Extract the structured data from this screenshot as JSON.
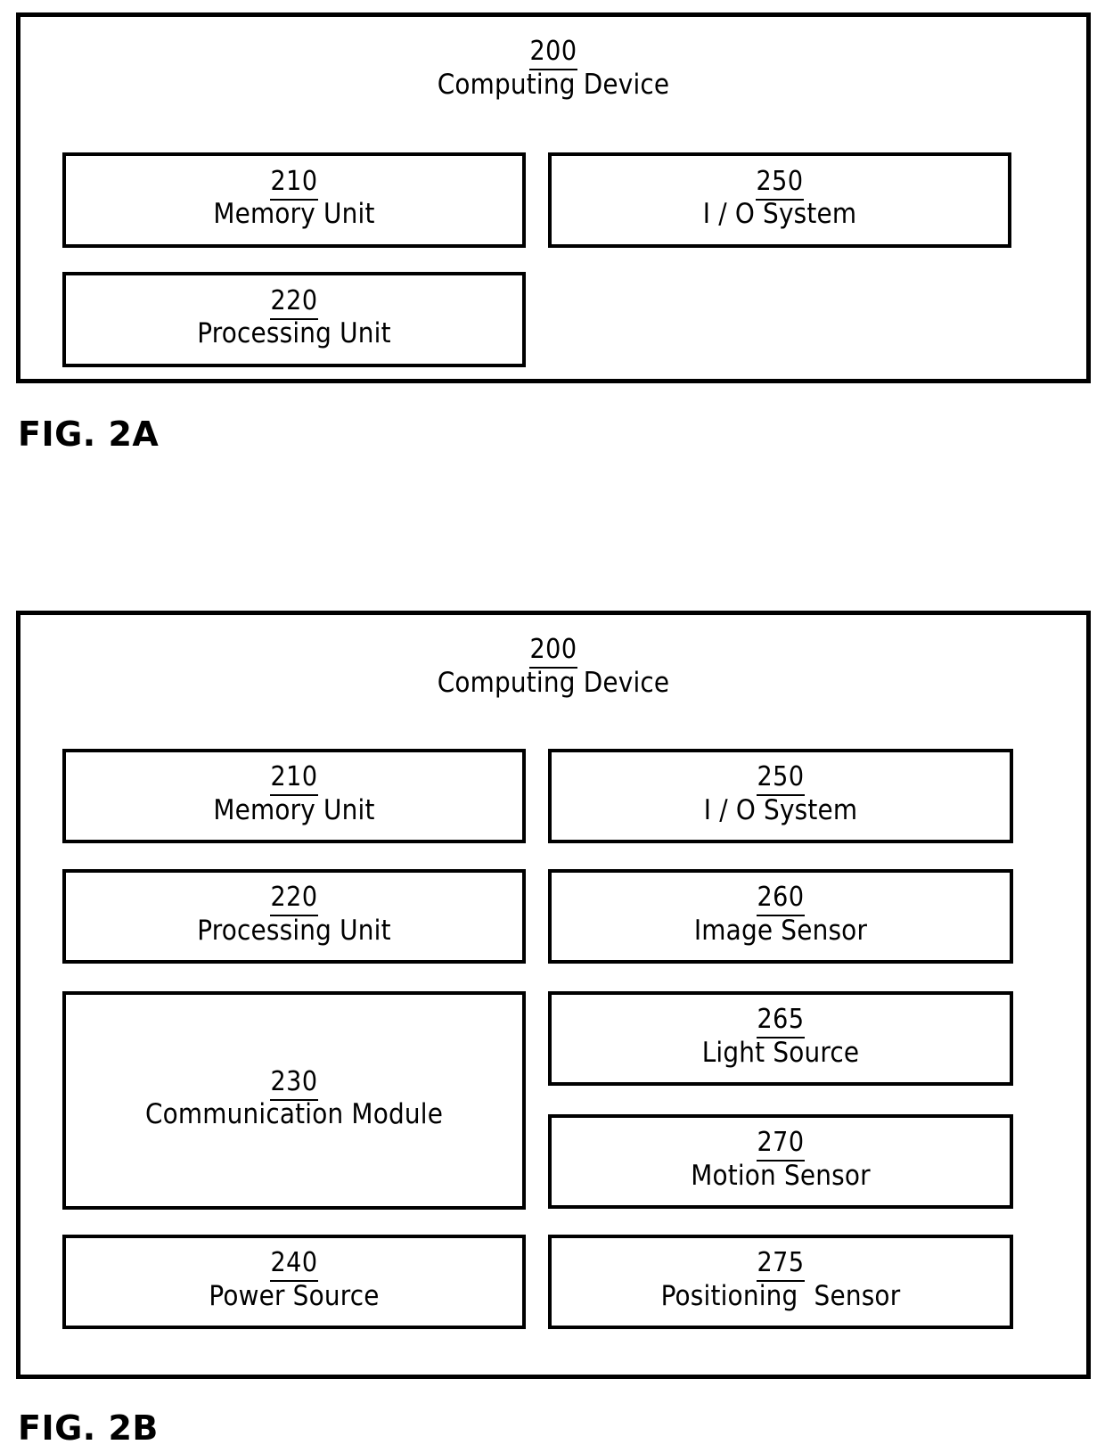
{
  "figures": [
    {
      "id": "fig-2a",
      "caption": "FIG. 2A",
      "container": {
        "ref": "200",
        "name": "Computing Device"
      },
      "blocks": [
        {
          "ref": "210",
          "name": "Memory Unit"
        },
        {
          "ref": "250",
          "name": "I / O System"
        },
        {
          "ref": "220",
          "name": "Processing Unit"
        }
      ]
    },
    {
      "id": "fig-2b",
      "caption": "FIG. 2B",
      "container": {
        "ref": "200",
        "name": "Computing Device"
      },
      "blocks": [
        {
          "ref": "210",
          "name": "Memory Unit"
        },
        {
          "ref": "250",
          "name": "I / O System"
        },
        {
          "ref": "220",
          "name": "Processing Unit"
        },
        {
          "ref": "260",
          "name": "Image Sensor"
        },
        {
          "ref": "230",
          "name": "Communication Module"
        },
        {
          "ref": "265",
          "name": "Light Source"
        },
        {
          "ref": "270",
          "name": "Motion Sensor"
        },
        {
          "ref": "240",
          "name": "Power Source"
        },
        {
          "ref": "275",
          "name": "Positioning  Sensor"
        }
      ]
    }
  ],
  "colors": {
    "line": "#000000",
    "background": "#ffffff",
    "text": "#000000"
  }
}
